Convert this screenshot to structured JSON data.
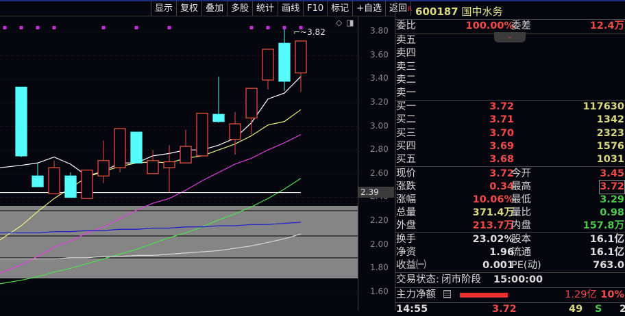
{
  "toolbar": [
    "显示",
    "复权",
    "叠加",
    "多股",
    "统计",
    "画线",
    "F10",
    "标记",
    "+自选",
    "返回"
  ],
  "chart": {
    "high_label": "3.82",
    "current_price_tag": "2.39",
    "y_ticks": [
      "3.80",
      "3.60",
      "3.40",
      "3.20",
      "3.00",
      "2.80",
      "2.60",
      "2.40",
      "2.20",
      "2.00",
      "1.80",
      "1.60"
    ],
    "candles": [
      {
        "o": 3.33,
        "c": 2.75,
        "h": 3.33,
        "l": 2.74
      },
      {
        "o": 2.58,
        "c": 2.49,
        "h": 2.69,
        "l": 2.49
      },
      {
        "o": 2.43,
        "c": 2.65,
        "h": 2.71,
        "l": 2.43
      },
      {
        "o": 2.58,
        "c": 2.4,
        "h": 2.61,
        "l": 2.4
      },
      {
        "o": 2.39,
        "c": 2.63,
        "h": 2.63,
        "l": 2.39
      },
      {
        "o": 2.58,
        "c": 2.71,
        "h": 2.88,
        "l": 2.52
      },
      {
        "o": 2.65,
        "c": 2.98,
        "h": 2.98,
        "l": 2.61
      },
      {
        "o": 2.95,
        "c": 2.69,
        "h": 2.95,
        "l": 2.69
      },
      {
        "o": 2.6,
        "c": 2.71,
        "h": 2.8,
        "l": 2.6
      },
      {
        "o": 2.65,
        "c": 2.7,
        "h": 2.84,
        "l": 2.44
      },
      {
        "o": 2.69,
        "c": 2.83,
        "h": 2.97,
        "l": 2.69
      },
      {
        "o": 2.75,
        "c": 3.11,
        "h": 3.11,
        "l": 2.75
      },
      {
        "o": 3.1,
        "c": 3.04,
        "h": 3.42,
        "l": 3.03
      },
      {
        "o": 2.89,
        "c": 3.02,
        "h": 3.12,
        "l": 2.76
      },
      {
        "o": 3.07,
        "c": 3.32,
        "h": 3.32,
        "l": 2.93
      },
      {
        "o": 3.39,
        "c": 3.65,
        "h": 3.65,
        "l": 3.31
      },
      {
        "o": 3.7,
        "c": 3.38,
        "h": 3.82,
        "l": 3.3
      },
      {
        "o": 3.45,
        "c": 3.72,
        "h": 3.72,
        "l": 3.29
      }
    ],
    "marker_indices": [
      -1,
      0,
      1,
      2,
      5,
      7,
      9,
      14,
      15,
      16,
      17
    ],
    "ma": [
      {
        "color": "#ffffff",
        "values": [
          2.67,
          2.69,
          2.74,
          2.68,
          2.58,
          2.62,
          2.69,
          2.69,
          2.75,
          2.77,
          2.8,
          2.8,
          2.84,
          2.9,
          3.03,
          3.23,
          3.28,
          3.42
        ]
      },
      {
        "color": "#f0f080",
        "values": [
          2.16,
          2.28,
          2.39,
          2.48,
          2.57,
          2.62,
          2.66,
          2.69,
          2.7,
          2.69,
          2.73,
          2.75,
          2.8,
          2.85,
          2.92,
          3.01,
          3.04,
          3.14
        ]
      },
      {
        "color": "#e040e0",
        "values": [
          1.83,
          1.9,
          1.98,
          2.03,
          2.1,
          2.15,
          2.22,
          2.29,
          2.35,
          2.39,
          2.46,
          2.54,
          2.61,
          2.68,
          2.73,
          2.8,
          2.86,
          2.93
        ]
      },
      {
        "color": "#50e050",
        "values": [
          1.7,
          1.73,
          1.77,
          1.8,
          1.84,
          1.88,
          1.92,
          1.96,
          2.01,
          2.06,
          2.1,
          2.15,
          2.21,
          2.26,
          2.32,
          2.39,
          2.47,
          2.56
        ]
      },
      {
        "color": "#1a1ad0",
        "values": [
          2.1,
          2.1,
          2.11,
          2.11,
          2.12,
          2.12,
          2.13,
          2.13,
          2.14,
          2.14,
          2.15,
          2.15,
          2.16,
          2.16,
          2.17,
          2.17,
          2.18,
          2.19
        ]
      },
      {
        "color": "#d8d8d8",
        "values": [
          1.88,
          1.88,
          1.88,
          1.89,
          1.89,
          1.9,
          1.9,
          1.91,
          1.91,
          1.92,
          1.93,
          1.94,
          1.95,
          1.97,
          1.99,
          2.02,
          2.05,
          2.09
        ]
      },
      {
        "color": "#ffffff",
        "values": [
          2.44,
          2.44,
          2.44,
          2.44,
          2.44,
          2.44,
          2.44,
          2.44,
          2.44,
          2.44,
          2.44,
          2.44,
          2.44,
          2.44,
          2.44,
          2.44,
          2.44,
          2.44
        ]
      }
    ]
  },
  "quote": {
    "flag": "R",
    "code": "600187",
    "name": "国中水务",
    "weibi_label": "委比",
    "weibi": "100.00%",
    "weicha_label": "委差",
    "weicha": "12.4万",
    "sell": [
      "卖五",
      "卖四",
      "卖三",
      "卖二",
      "卖一"
    ],
    "buy": [
      {
        "label": "买一",
        "price": "3.72",
        "vol": "117630"
      },
      {
        "label": "买二",
        "price": "3.71",
        "vol": "1342"
      },
      {
        "label": "买三",
        "price": "3.70",
        "vol": "2323"
      },
      {
        "label": "买四",
        "price": "3.69",
        "vol": "1576"
      },
      {
        "label": "买五",
        "price": "3.68",
        "vol": "1031"
      }
    ],
    "stats": [
      {
        "l1": "现价",
        "v1": "3.72",
        "c1": "red",
        "l2": "今开",
        "v2": "3.45",
        "c2": "red"
      },
      {
        "l1": "涨跌",
        "v1": "0.34",
        "c1": "red",
        "l2": "最高",
        "v2": "3.72",
        "c2": "red"
      },
      {
        "l1": "涨幅",
        "v1": "10.06%",
        "c1": "red",
        "l2": "最低",
        "v2": "3.29",
        "c2": "grn"
      },
      {
        "l1": "总量",
        "v1": "371.4万",
        "c1": "ylw",
        "l2": "量比",
        "v2": "0.98",
        "c2": "grn"
      },
      {
        "l1": "外盘",
        "v1": "213.7万",
        "c1": "red",
        "l2": "内盘",
        "v2": "157.8万",
        "c2": "grn"
      }
    ],
    "fund": [
      {
        "l1": "换手",
        "v1": "23.02%",
        "l2": "股本",
        "v2": "16.1亿"
      },
      {
        "l1": "净资",
        "v1": "1.96",
        "l2": "流通",
        "v2": "16.1亿"
      },
      {
        "l1": "收益㈠",
        "v1": "0.001",
        "l2": "PE(动)",
        "v2": "763.0"
      }
    ],
    "status_label": "交易状态:",
    "status": "闭市阶段",
    "status_time": "15:00:00",
    "main_label": "主力净额",
    "main_value": "1.29亿",
    "main_pct": "10%",
    "main_pct_fill": 0.1,
    "tick": {
      "time": "14:55",
      "price": "3.72",
      "vol": "49",
      "side": "S",
      "count": "2"
    }
  }
}
